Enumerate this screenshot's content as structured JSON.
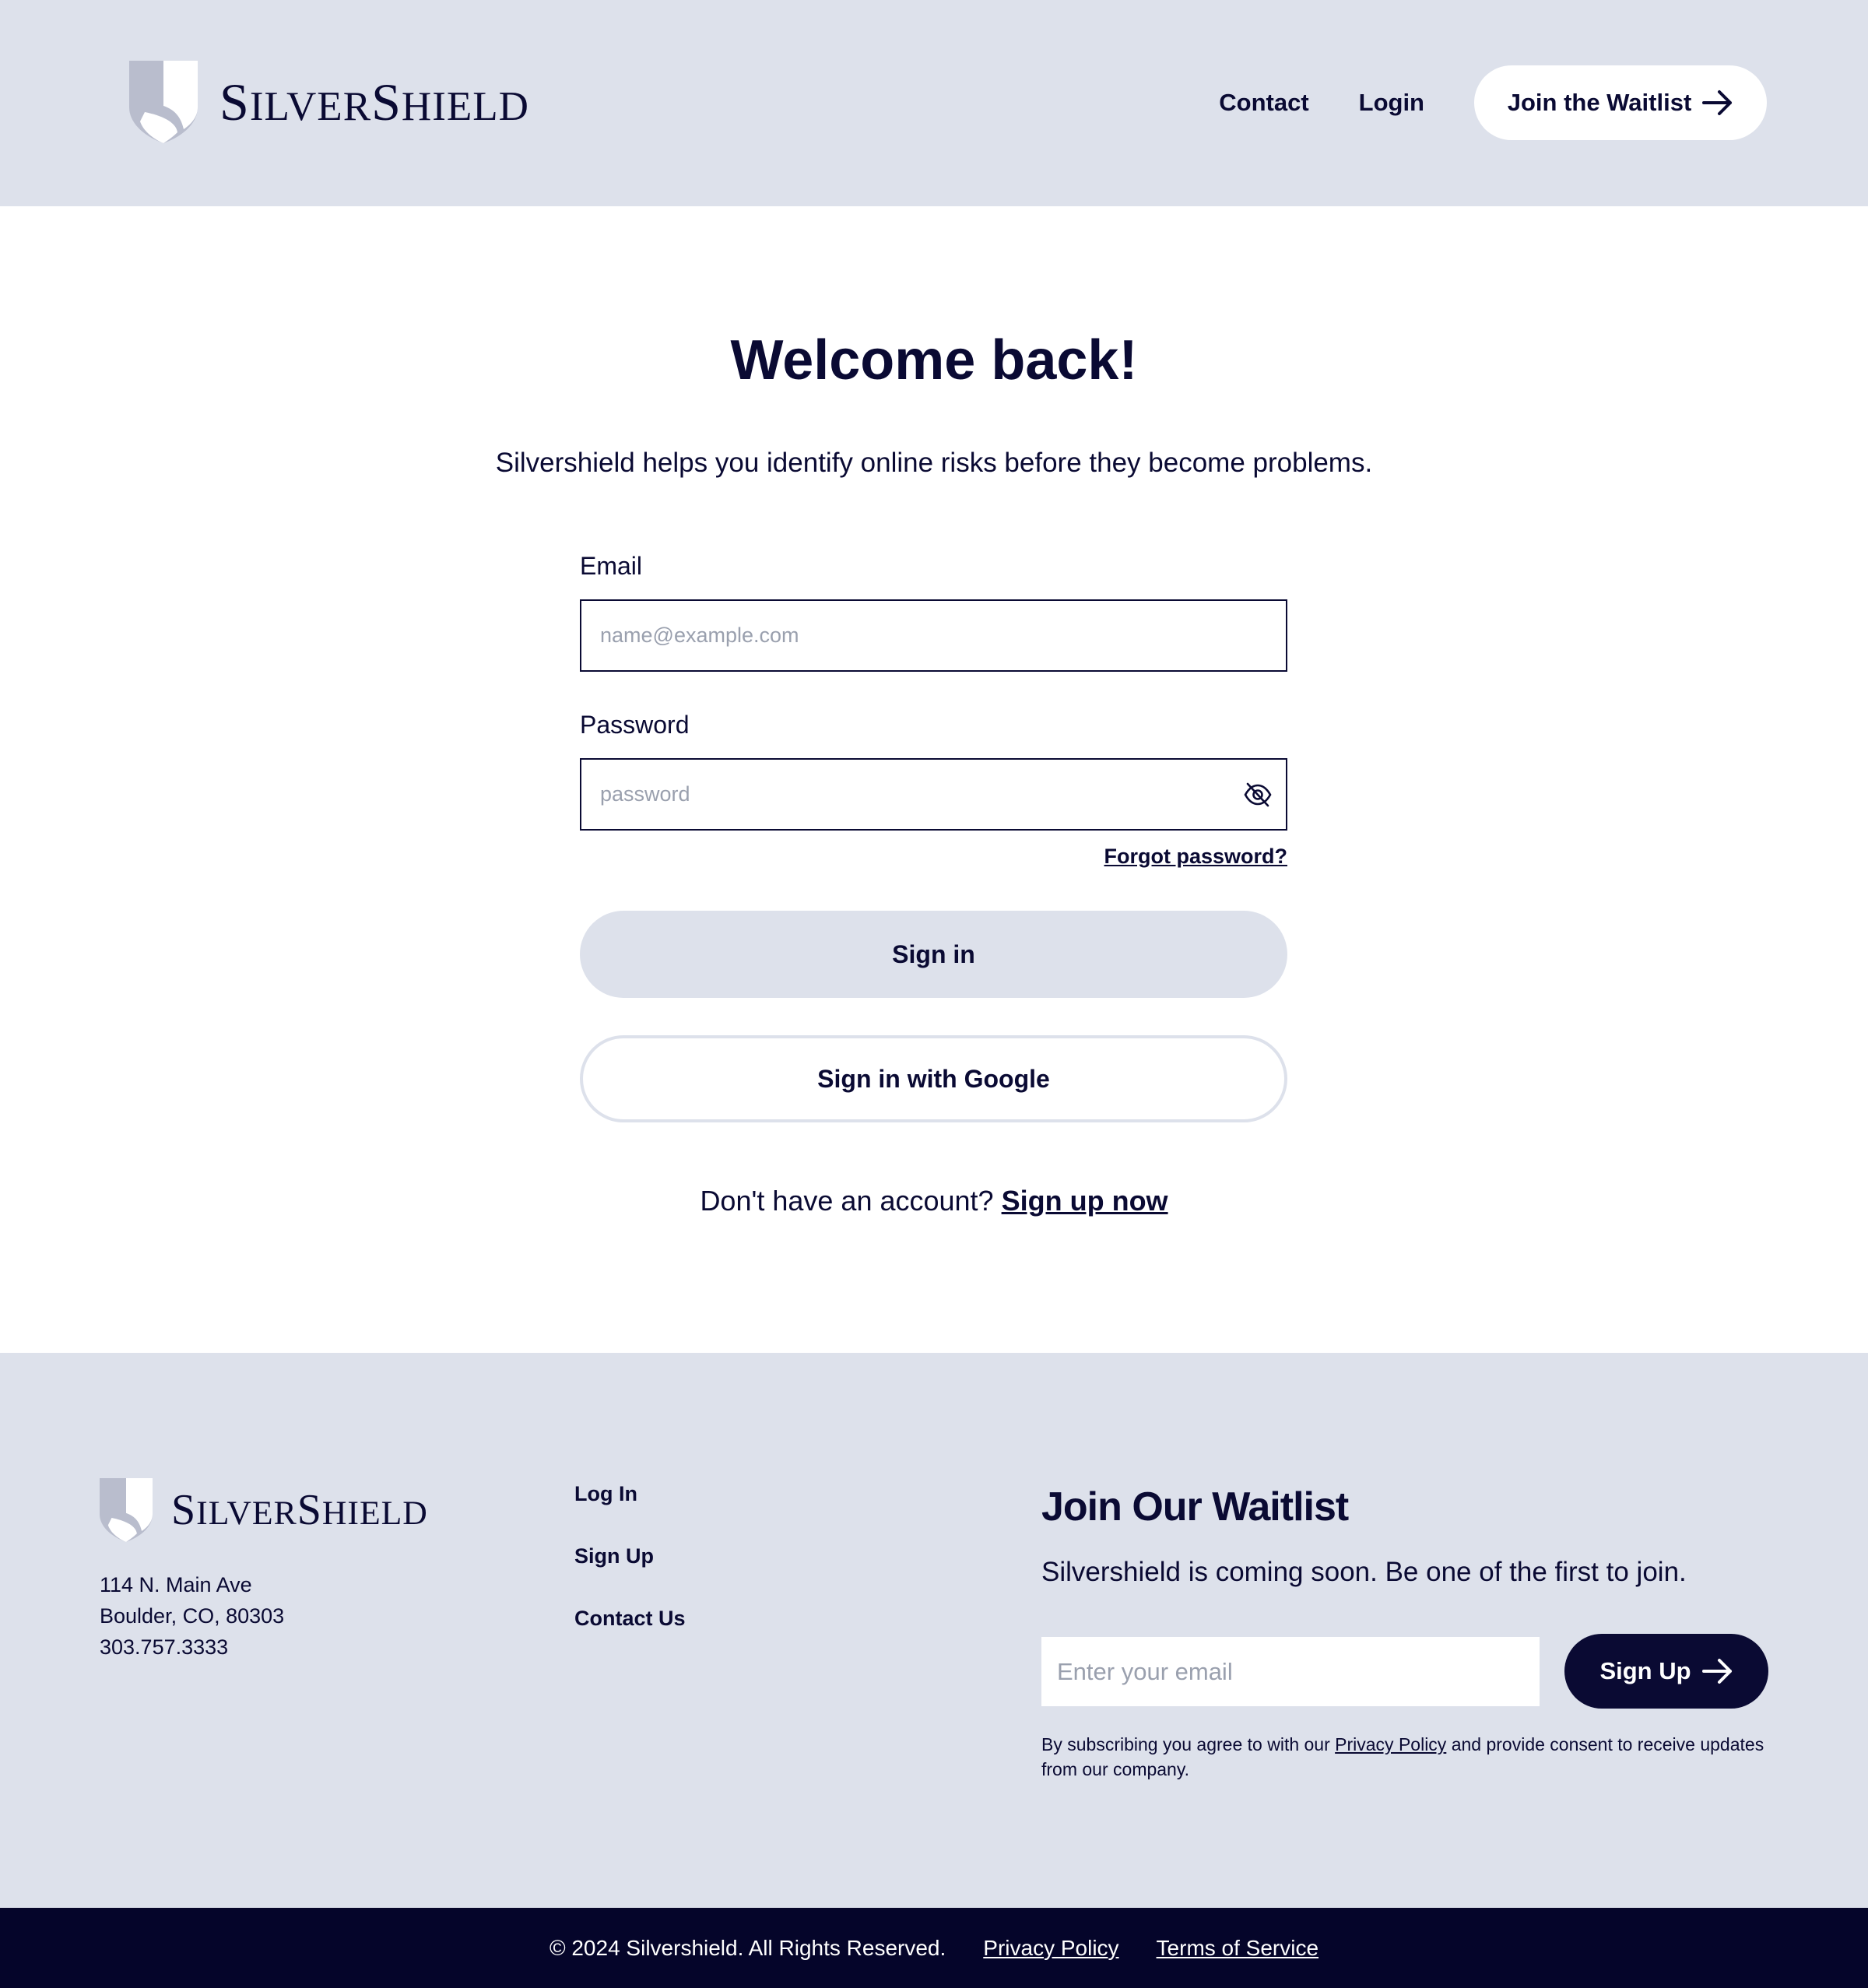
{
  "brand": {
    "name_parts": [
      {
        "text": "S",
        "cls": "cap"
      },
      {
        "text": "ILVER",
        "cls": "sc"
      },
      {
        "text": "S",
        "cls": "cap"
      },
      {
        "text": "HIELD",
        "cls": "sc"
      }
    ],
    "icon": "shield-icon",
    "colors": {
      "navy": "#0a0a33",
      "light": "#dde1eb",
      "shield_gray": "#b9bdcd"
    }
  },
  "header": {
    "nav": {
      "contact": "Contact",
      "login": "Login"
    },
    "cta": {
      "label": "Join the Waitlist",
      "icon": "arrow-right-icon"
    }
  },
  "main": {
    "title": "Welcome back!",
    "subtitle": "Silvershield helps you identify online risks before they become problems.",
    "form": {
      "email_label": "Email",
      "email_placeholder": "name@example.com",
      "email_value": "",
      "password_label": "Password",
      "password_placeholder": "password",
      "password_value": "",
      "password_toggle_icon": "eye-off-icon",
      "forgot": "Forgot password?",
      "signin": "Sign in",
      "google": "Sign in with Google"
    },
    "signup_prompt": "Don't have an account?",
    "signup_link": "Sign up now"
  },
  "footer": {
    "address": [
      "114 N. Main Ave",
      "Boulder, CO, 80303",
      "303.757.3333"
    ],
    "links": [
      "Log In",
      "Sign Up",
      "Contact Us"
    ],
    "waitlist": {
      "title": "Join Our Waitlist",
      "subtitle": "Silvershield is coming soon. Be one of the first to join.",
      "email_placeholder": "Enter your email",
      "button": "Sign Up",
      "consent_before": "By subscribing you agree to with our",
      "consent_link": "Privacy Policy",
      "consent_after": "and provide consent to receive updates from our company."
    }
  },
  "bottom_bar": {
    "copyright": "© 2024 Silvershield. All Rights Reserved.",
    "privacy": "Privacy Policy",
    "terms": "Terms of Service"
  }
}
